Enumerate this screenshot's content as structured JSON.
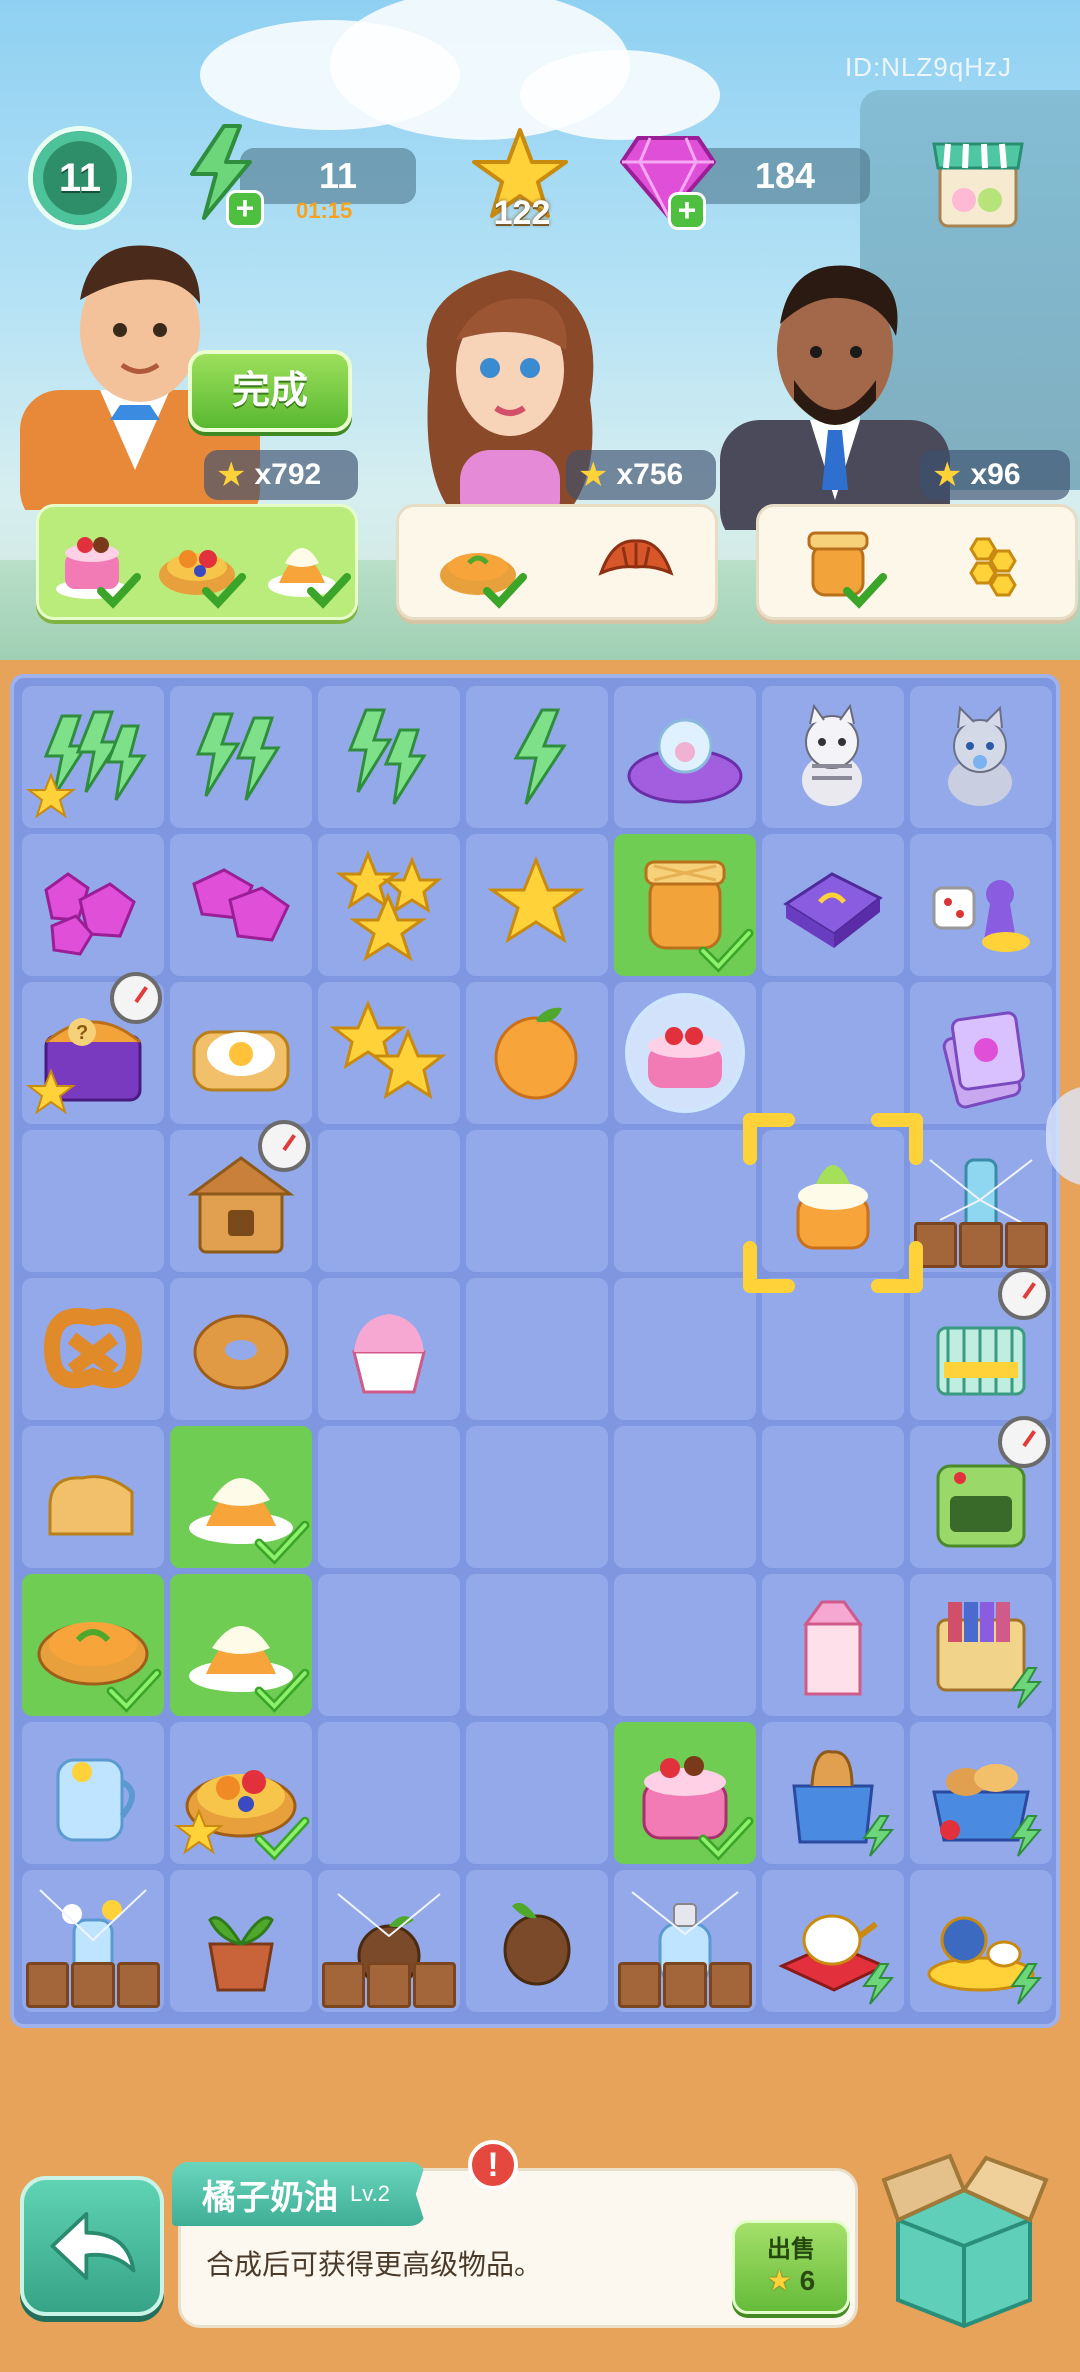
{
  "header": {
    "player_id": "ID:NLZ9qHzJ",
    "level": "11",
    "energy": {
      "value": "11",
      "timer": "01:15"
    },
    "stars": "122",
    "gems": "184"
  },
  "customers": [
    {
      "reward": "x792",
      "done_label": "完成",
      "order_complete": true,
      "items": [
        {
          "icon": "strawberry-cake-icon",
          "checked": true
        },
        {
          "icon": "fruit-tart-icon",
          "checked": true
        },
        {
          "icon": "orange-cream-icon",
          "checked": true
        }
      ]
    },
    {
      "reward": "x756",
      "order_complete": false,
      "items": [
        {
          "icon": "orange-pie-icon",
          "checked": true
        },
        {
          "icon": "croissant-icon",
          "checked": false
        }
      ]
    },
    {
      "reward": "x96",
      "order_complete": false,
      "items": [
        {
          "icon": "jam-jar-icon",
          "checked": true
        },
        {
          "icon": "honeycomb-icon",
          "checked": false
        }
      ]
    }
  ],
  "board": {
    "columns": 7,
    "rows": 9,
    "cells": [
      [
        "energy-stack-large",
        "energy-stack-medium",
        "energy-double",
        "energy-single",
        "snow-globe-board",
        "striped-cat",
        "gray-cat"
      ],
      [
        "gem-stack-large",
        "gem-double",
        "star-stack-large",
        "star-single",
        "jam-jar",
        "game-box",
        "dice-game"
      ],
      [
        "mystery-chest",
        "egg-toast",
        "star-double",
        "orange",
        "strawberry-cake-bubble",
        "empty",
        "card-pack"
      ],
      [
        "empty",
        "beehive",
        "empty",
        "empty",
        "empty",
        "orange-cream",
        "milk-bottle-cobweb"
      ],
      [
        "pretzel",
        "bagel",
        "cream-cup",
        "empty",
        "empty",
        "empty",
        "baby-crib"
      ],
      [
        "bread-slice",
        "orange-cream-plate",
        "empty",
        "empty",
        "empty",
        "empty",
        "stove"
      ],
      [
        "orange-pie",
        "orange-cream-plate",
        "empty",
        "empty",
        "empty",
        "milk-carton",
        "book-cart"
      ],
      [
        "juice-jar",
        "fruit-tart",
        "empty",
        "empty",
        "strawberry-cake",
        "bread-bag",
        "bread-basket"
      ],
      [
        "flower-vase-cobweb",
        "plant-pot",
        "seed-pot-cobweb",
        "seed",
        "perfume-cobweb",
        "teapot-tray",
        "tea-set"
      ]
    ]
  },
  "selected_item": {
    "name": "橘子奶油",
    "level": "Lv.2",
    "description": "合成后可获得更高级物品。",
    "alert": "!",
    "sell_label": "出售",
    "sell_value": "6"
  },
  "colors": {
    "board": "#7f97e0",
    "cell": "#93a9ea",
    "highlight": "#6ecd52",
    "accent_green": "#59b830",
    "panel": "#fdf8ef"
  }
}
